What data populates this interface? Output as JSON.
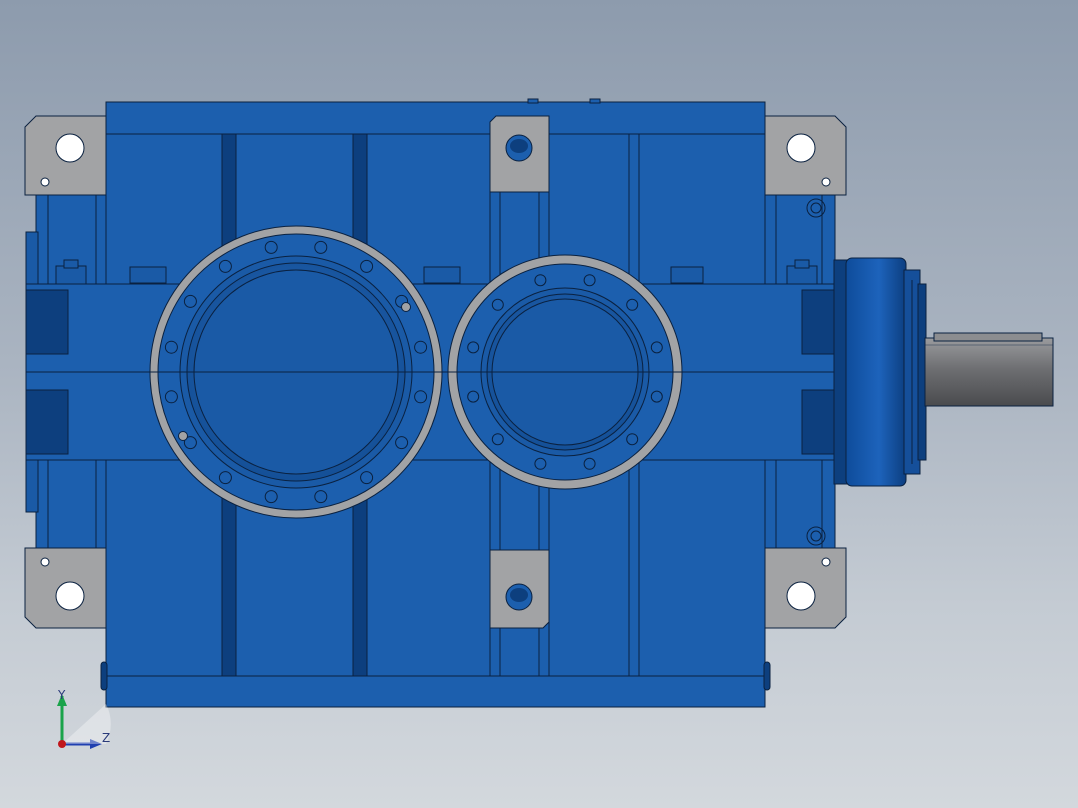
{
  "viewport": {
    "background_top": "#8d9bad",
    "background_bottom": "#d3d8dd"
  },
  "model": {
    "housing_color": "#1c5fae",
    "housing_dark": "#0d3f7e",
    "edge_color": "#0a2140",
    "flange_color": "#a2a3a5",
    "shaft_color": "#6f7073"
  },
  "triad": {
    "y_label": "Y",
    "z_label": "Z",
    "y_color": "#1aa34a",
    "z_color": "#1f3fb0",
    "origin_color": "#c0171c"
  }
}
